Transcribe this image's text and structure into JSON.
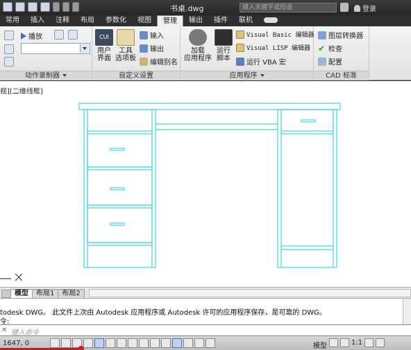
{
  "titlebar": {
    "title": "书桌.dwg",
    "search_placeholder": "键入关键字或短语",
    "login": "登录"
  },
  "tabs": [
    "常用",
    "插入",
    "注释",
    "布局",
    "参数化",
    "视图",
    "管理",
    "输出",
    "插件",
    "联机"
  ],
  "active_tab": "管理",
  "ribbon": {
    "action_recorder": {
      "play_label": "播放",
      "panel_title": "动作录制器"
    },
    "customization": {
      "user_interface_label": "用户\n界面",
      "tool_palettes_label": "工具\n选项板",
      "input_label": "输入",
      "output_label": "输出",
      "edit_aliases_label": "编辑别名",
      "panel_title": "自定义设置"
    },
    "applications": {
      "load_app_label": "加载\n应用程序",
      "run_script_label": "运行\n脚本",
      "vb_editor_label": "Visual Basic 编辑器",
      "lisp_editor_label": "Visual LISP 编辑器",
      "run_vba_label": "运行 VBA 宏",
      "panel_title": "应用程序"
    },
    "cad_standards": {
      "layer_translator_label": "图层转换器",
      "check_label": "检查",
      "configure_label": "配置",
      "panel_title": "CAD 标准"
    }
  },
  "drawing": {
    "view_label": "视][二维线框]"
  },
  "layout_tabs": [
    "模型",
    "布局1",
    "布局2"
  ],
  "active_layout": "模型",
  "command": {
    "history_line": "todesk DWG。  此文件上次由 Autodesk 应用程序或 Autodesk 许可的应用程序保存，是可靠的 DWG。",
    "prompt_line": "令:",
    "input_placeholder": "键入命令"
  },
  "statusbar": {
    "coords": "1647, 0",
    "model_label": "模型",
    "scale": "1:1"
  },
  "colors": {
    "drawing_lines": "#3fd6e4",
    "ribbon_bg": "#eeeeee",
    "titlebar_bg": "#303030"
  }
}
